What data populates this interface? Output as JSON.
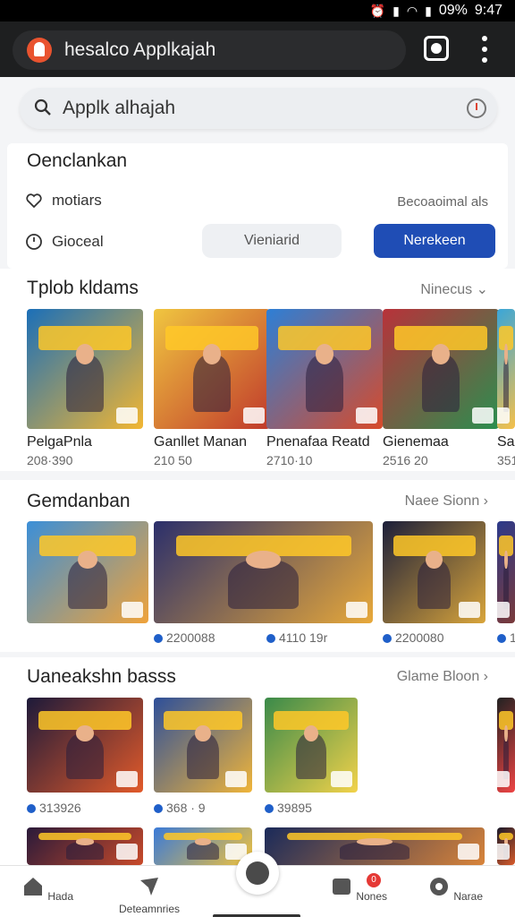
{
  "status_bar": {
    "battery": "09%",
    "time": "9:47"
  },
  "browser": {
    "url": "hesalco Applkajah"
  },
  "search": {
    "query": "Applk alhajah"
  },
  "filters": {
    "title": "Oenclankan",
    "row1_label": "motiars",
    "row1_right": "Becoaoimal als",
    "row2_label": "Gioceal",
    "secondary_button": "Vieniarid",
    "primary_button": "Nerekeen"
  },
  "section1": {
    "title": "Tplob kldams",
    "more": "Ninecus",
    "items": [
      {
        "name": "PelgaPnla",
        "meta": "208·390",
        "palette": [
          "#1b6fb8",
          "#f2b632"
        ]
      },
      {
        "name": "Ganllet Manan",
        "meta": "210 50",
        "palette": [
          "#f0c640",
          "#c0392b"
        ]
      },
      {
        "name": "Pnenafaa Reatd",
        "meta": "2710·10",
        "palette": [
          "#2d7fd6",
          "#d84a2a"
        ]
      },
      {
        "name": "Gienemaa",
        "meta": "2516 20",
        "palette": [
          "#b8323a",
          "#2a8f4f"
        ]
      },
      {
        "name": "San",
        "meta": "351",
        "palette": [
          "#3aa6d8",
          "#f5c04a"
        ]
      }
    ]
  },
  "section2": {
    "title": "Gemdanban",
    "more": "Naee Sionn",
    "items": [
      {
        "meta": "",
        "palette": [
          "#3b8fd8",
          "#f0a33a"
        ]
      },
      {
        "meta": "2200088",
        "palette": [
          "#2b2f6b",
          "#e8a93a"
        ]
      },
      {
        "meta": "4110 19r",
        "palette": [
          "#1c1f3a",
          "#d9a53b"
        ]
      },
      {
        "meta": "2200080",
        "palette": [
          "#2c3a8a",
          "#7a3a3a"
        ]
      },
      {
        "meta": "1",
        "palette": [
          "#222",
          "#444"
        ]
      }
    ]
  },
  "section3": {
    "title": "Uaneakshn basss",
    "more": "Glame Bloon",
    "items": [
      {
        "meta": "313926",
        "palette": [
          "#1d1a3a",
          "#e25a2a"
        ]
      },
      {
        "meta": "368 · 9",
        "palette": [
          "#2d4f9a",
          "#f0b53a"
        ]
      },
      {
        "meta": "39895",
        "palette": [
          "#3a8a4a",
          "#f2d24a"
        ]
      },
      {
        "meta": "",
        "palette": [
          "#222",
          "#e44"
        ]
      }
    ],
    "row2_palettes": [
      [
        "#2a1a3a",
        "#c84a2a"
      ],
      [
        "#3a7ad8",
        "#f2c23a"
      ],
      [
        "#1a2a5a",
        "#d8843a"
      ],
      [
        "#1a1a2a",
        "#d85a2a"
      ]
    ]
  },
  "bottom_nav": {
    "items": [
      {
        "label": "Hada"
      },
      {
        "label": "Deteamnries"
      },
      {
        "label": "Nones",
        "badge": "0"
      },
      {
        "label": "Narae"
      }
    ]
  }
}
